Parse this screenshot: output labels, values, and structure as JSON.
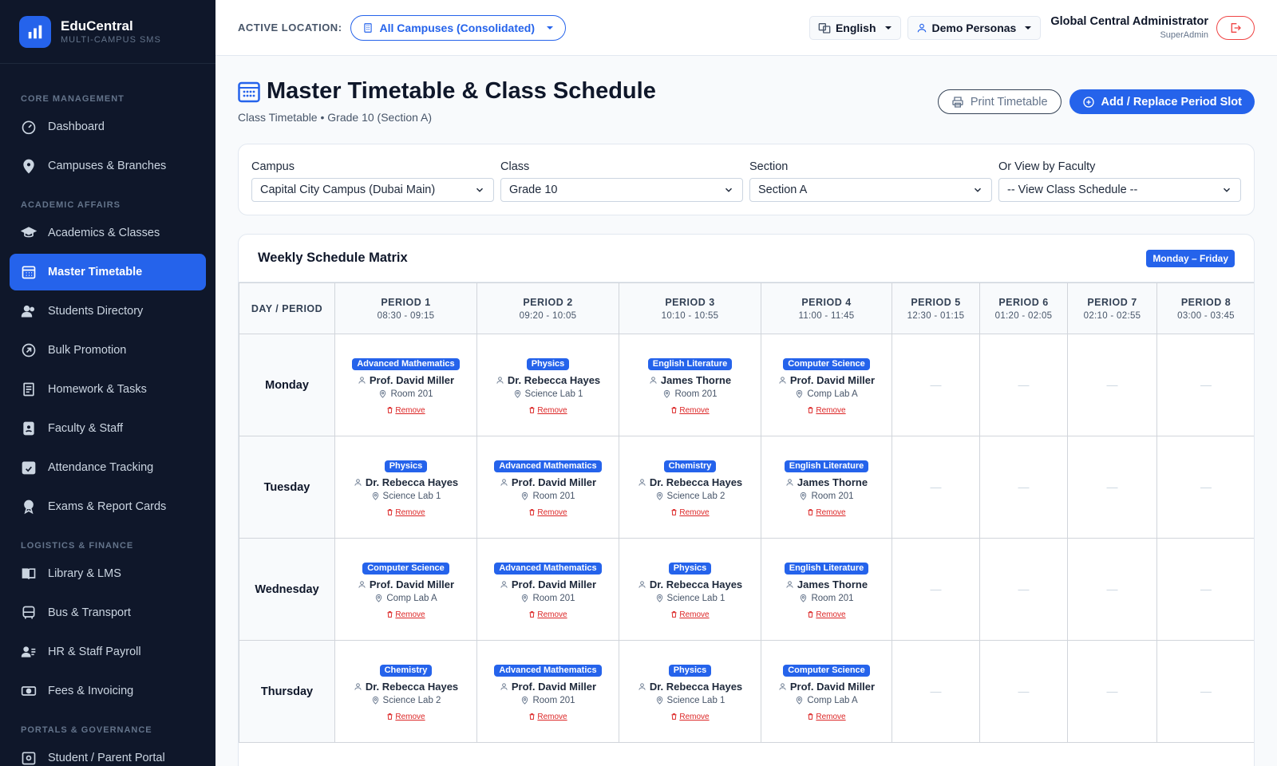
{
  "brand": {
    "name": "EduCentral",
    "subtitle": "MULTI-CAMPUS SMS"
  },
  "sidebar": {
    "sections": [
      {
        "label": "CORE MANAGEMENT",
        "items": [
          {
            "label": "Dashboard",
            "icon": "dashboard-icon"
          },
          {
            "label": "Campuses & Branches",
            "icon": "map-pin-icon"
          }
        ]
      },
      {
        "label": "ACADEMIC AFFAIRS",
        "items": [
          {
            "label": "Academics & Classes",
            "icon": "graduation-cap-icon"
          },
          {
            "label": "Master Timetable",
            "icon": "calendar-grid-icon",
            "active": true
          },
          {
            "label": "Students Directory",
            "icon": "users-icon"
          },
          {
            "label": "Bulk Promotion",
            "icon": "arrow-up-right-icon"
          },
          {
            "label": "Homework & Tasks",
            "icon": "clipboard-list-icon"
          },
          {
            "label": "Faculty & Staff",
            "icon": "id-badge-icon"
          },
          {
            "label": "Attendance Tracking",
            "icon": "calendar-check-icon"
          },
          {
            "label": "Exams & Report Cards",
            "icon": "award-icon"
          }
        ]
      },
      {
        "label": "LOGISTICS & FINANCE",
        "items": [
          {
            "label": "Library & LMS",
            "icon": "book-open-icon"
          },
          {
            "label": "Bus & Transport",
            "icon": "bus-icon"
          },
          {
            "label": "HR & Staff Payroll",
            "icon": "user-list-icon"
          },
          {
            "label": "Fees & Invoicing",
            "icon": "banknote-icon"
          }
        ]
      },
      {
        "label": "PORTALS & GOVERNANCE",
        "items": [
          {
            "label": "Student / Parent Portal",
            "icon": "portal-icon"
          }
        ]
      }
    ]
  },
  "topbar": {
    "location_label": "ACTIVE LOCATION:",
    "location_value": "All Campuses (Consolidated)",
    "language": "English",
    "personas": "Demo Personas",
    "admin_name": "Global Central Administrator",
    "admin_role": "SuperAdmin"
  },
  "page": {
    "title": "Master Timetable & Class Schedule",
    "subtitle": "Class Timetable • Grade 10 (Section A)",
    "print_label": "Print Timetable",
    "add_label": "Add / Replace Period Slot"
  },
  "filters": [
    {
      "label": "Campus",
      "value": "Capital City Campus (Dubai Main)"
    },
    {
      "label": "Class",
      "value": "Grade 10"
    },
    {
      "label": "Section",
      "value": "Section A"
    },
    {
      "label": "Or View by Faculty",
      "value": "-- View Class Schedule --"
    }
  ],
  "matrix": {
    "title": "Weekly Schedule Matrix",
    "range": "Monday – Friday",
    "corner": "DAY / PERIOD",
    "remove_label": "Remove",
    "empty_mark": "—",
    "periods": [
      {
        "name": "PERIOD 1",
        "time": "08:30 - 09:15"
      },
      {
        "name": "PERIOD 2",
        "time": "09:20 - 10:05"
      },
      {
        "name": "PERIOD 3",
        "time": "10:10 - 10:55"
      },
      {
        "name": "PERIOD 4",
        "time": "11:00 - 11:45"
      },
      {
        "name": "PERIOD 5",
        "time": "12:30 - 01:15"
      },
      {
        "name": "PERIOD 6",
        "time": "01:20 - 02:05"
      },
      {
        "name": "PERIOD 7",
        "time": "02:10 - 02:55"
      },
      {
        "name": "PERIOD 8",
        "time": "03:00 - 03:45"
      }
    ],
    "rows": [
      {
        "day": "Monday",
        "slots": [
          {
            "subject": "Advanced Mathematics",
            "teacher": "Prof. David Miller",
            "room": "Room 201"
          },
          {
            "subject": "Physics",
            "teacher": "Dr. Rebecca Hayes",
            "room": "Science Lab 1"
          },
          {
            "subject": "English Literature",
            "teacher": "James Thorne",
            "room": "Room 201"
          },
          {
            "subject": "Computer Science",
            "teacher": "Prof. David Miller",
            "room": "Comp Lab A"
          }
        ]
      },
      {
        "day": "Tuesday",
        "slots": [
          {
            "subject": "Physics",
            "teacher": "Dr. Rebecca Hayes",
            "room": "Science Lab 1"
          },
          {
            "subject": "Advanced Mathematics",
            "teacher": "Prof. David Miller",
            "room": "Room 201"
          },
          {
            "subject": "Chemistry",
            "teacher": "Dr. Rebecca Hayes",
            "room": "Science Lab 2"
          },
          {
            "subject": "English Literature",
            "teacher": "James Thorne",
            "room": "Room 201"
          }
        ]
      },
      {
        "day": "Wednesday",
        "slots": [
          {
            "subject": "Computer Science",
            "teacher": "Prof. David Miller",
            "room": "Comp Lab A"
          },
          {
            "subject": "Advanced Mathematics",
            "teacher": "Prof. David Miller",
            "room": "Room 201"
          },
          {
            "subject": "Physics",
            "teacher": "Dr. Rebecca Hayes",
            "room": "Science Lab 1"
          },
          {
            "subject": "English Literature",
            "teacher": "James Thorne",
            "room": "Room 201"
          }
        ]
      },
      {
        "day": "Thursday",
        "slots": [
          {
            "subject": "Chemistry",
            "teacher": "Dr. Rebecca Hayes",
            "room": "Science Lab 2"
          },
          {
            "subject": "Advanced Mathematics",
            "teacher": "Prof. David Miller",
            "room": "Room 201"
          },
          {
            "subject": "Physics",
            "teacher": "Dr. Rebecca Hayes",
            "room": "Science Lab 1"
          },
          {
            "subject": "Computer Science",
            "teacher": "Prof. David Miller",
            "room": "Comp Lab A"
          }
        ]
      }
    ]
  },
  "colors": {
    "accent": "#2563eb",
    "sidebar_bg": "#0f172a",
    "danger": "#dc2626"
  }
}
